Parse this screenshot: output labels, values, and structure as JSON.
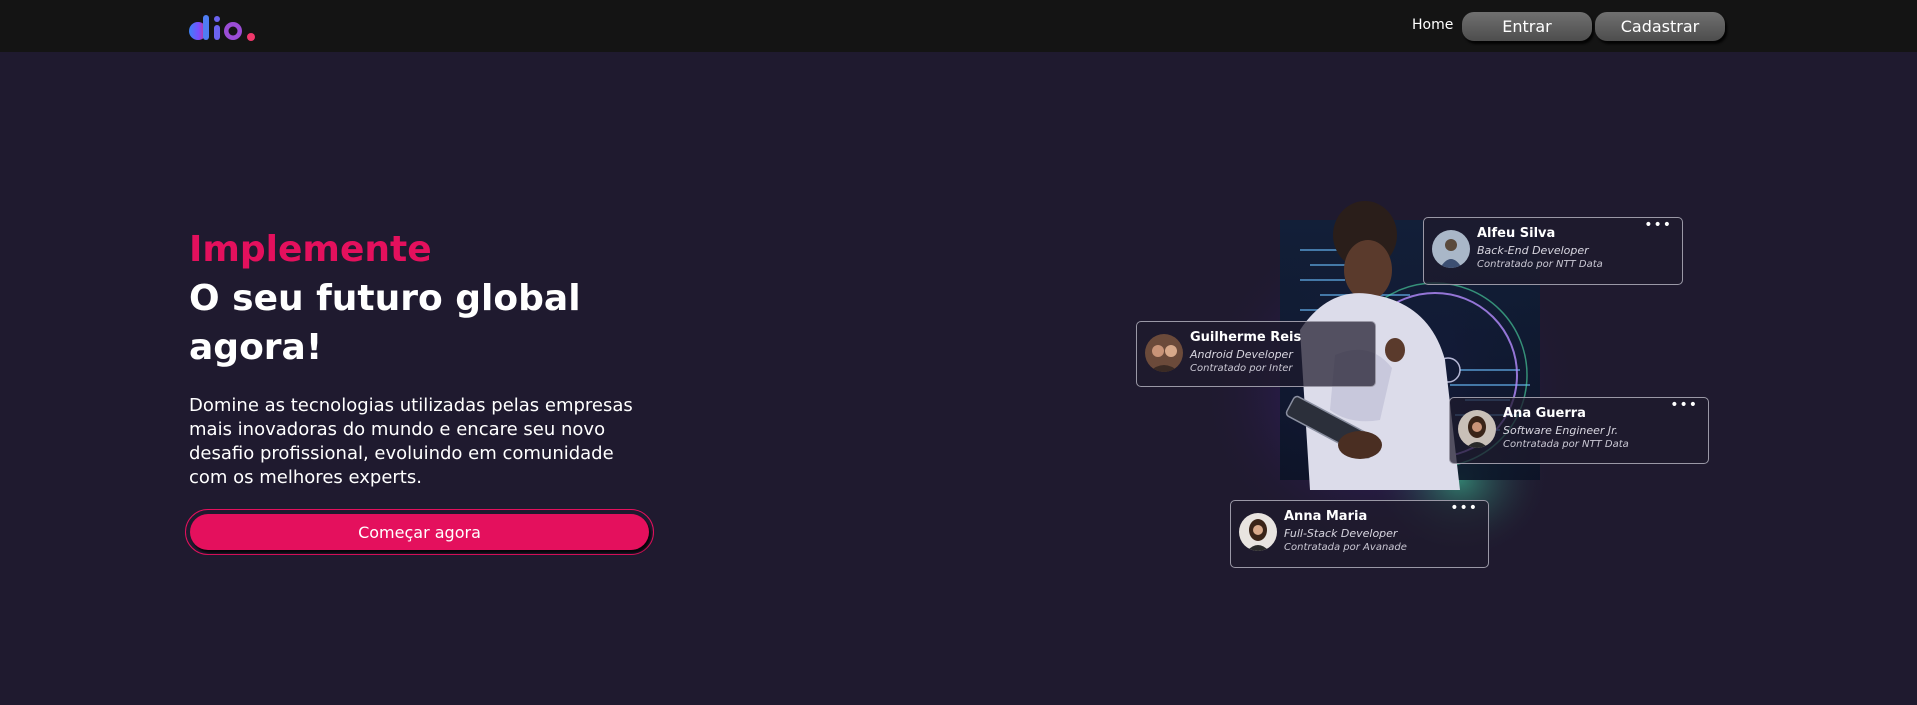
{
  "header": {
    "logo_alt": "dio",
    "nav_home": "Home",
    "btn_entrar": "Entrar",
    "btn_cadastrar": "Cadastrar"
  },
  "hero": {
    "kicker": "Implemente",
    "title": "O seu futuro global agora!",
    "description": "Domine as tecnologias utilizadas pelas empresas mais inovadoras do mundo e encare seu novo desafio profissional, evoluindo em comunidade com os melhores experts.",
    "cta": "Começar agora"
  },
  "cards": [
    {
      "name": "Alfeu Silva",
      "role": "Back-End Developer",
      "company": "Contratado por NTT Data"
    },
    {
      "name": "Guilherme Reis",
      "role": "Android Developer",
      "company": "Contratado por Inter"
    },
    {
      "name": "Ana Guerra",
      "role": "Software Engineer Jr.",
      "company": "Contratada por NTT Data"
    },
    {
      "name": "Anna Maria",
      "role": "Full-Stack Developer",
      "company": "Contratada por Avanade"
    }
  ],
  "colors": {
    "background": "#1f1a2f",
    "header": "#141414",
    "accent": "#e4105d"
  }
}
